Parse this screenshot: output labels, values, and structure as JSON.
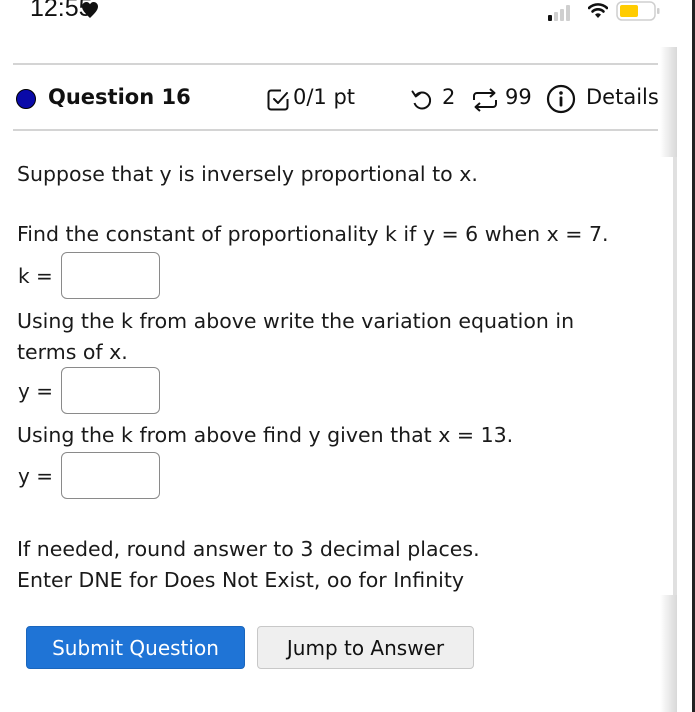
{
  "status_bar": {
    "time": "12:55",
    "icons": [
      "heart-icon",
      "cellular-signal-icon",
      "wifi-icon",
      "battery-icon"
    ],
    "battery_color": "#ffcc00"
  },
  "question": {
    "title": "Question 16",
    "status_dot_color": "#0a0aa8",
    "score": "0/1 pt",
    "retries": "2",
    "attempts": "99",
    "details_label": "Details",
    "icons": {
      "score": "checkbox-icon",
      "retries": "undo-icon",
      "attempts": "repeat-icon",
      "details": "info-icon"
    }
  },
  "body": {
    "intro": "Suppose that y is inversely proportional to x.",
    "part1_prompt": "Find the constant of proportionality k if y = 6 when x = 7.",
    "part1_label": "k =",
    "part1_value": "",
    "part2_prompt_line1": "Using the k from above write the variation equation in",
    "part2_prompt_line2": "terms of x.",
    "part2_label": "y =",
    "part2_value": "",
    "part3_prompt": "Using the k from above find y given that x = 13.",
    "part3_label": "y =",
    "part3_value": "",
    "note_line1": "If needed, round answer to 3 decimal places.",
    "note_line2": "Enter DNE for Does Not Exist, oo for Infinity"
  },
  "actions": {
    "submit_label": "Submit Question",
    "jump_label": "Jump to Answer",
    "submit_color": "#1f74d6"
  }
}
